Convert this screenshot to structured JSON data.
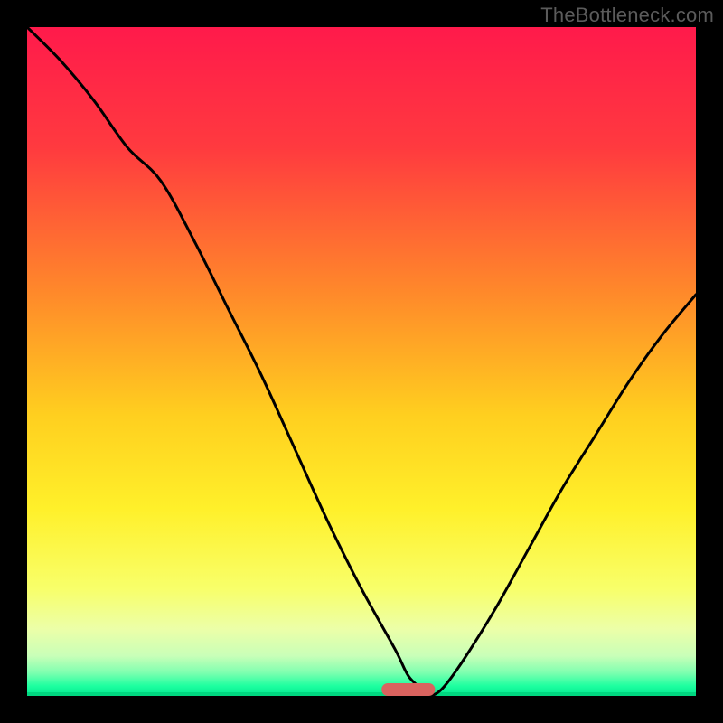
{
  "watermark": "TheBottleneck.com",
  "chart_data": {
    "type": "line",
    "title": "",
    "xlabel": "",
    "ylabel": "",
    "xlim": [
      0,
      100
    ],
    "ylim": [
      0,
      100
    ],
    "series": [
      {
        "name": "bottleneck-curve",
        "x": [
          0,
          5,
          10,
          15,
          20,
          25,
          30,
          35,
          40,
          45,
          50,
          55,
          57,
          59,
          60,
          62,
          65,
          70,
          75,
          80,
          85,
          90,
          95,
          100
        ],
        "y": [
          100,
          95,
          89,
          82,
          77,
          68,
          58,
          48,
          37,
          26,
          16,
          7,
          3,
          1,
          0,
          1,
          5,
          13,
          22,
          31,
          39,
          47,
          54,
          60
        ]
      }
    ],
    "marker": {
      "name": "sweet-spot",
      "x": 57,
      "width": 8,
      "color": "#d9635f"
    },
    "gradient_stops": [
      {
        "pos": 0.0,
        "color": "#ff1a4b"
      },
      {
        "pos": 0.18,
        "color": "#ff3a3f"
      },
      {
        "pos": 0.4,
        "color": "#ff8a2a"
      },
      {
        "pos": 0.58,
        "color": "#ffcf1f"
      },
      {
        "pos": 0.72,
        "color": "#fff02a"
      },
      {
        "pos": 0.84,
        "color": "#f8ff6a"
      },
      {
        "pos": 0.9,
        "color": "#ecffa8"
      },
      {
        "pos": 0.94,
        "color": "#c9ffb8"
      },
      {
        "pos": 0.965,
        "color": "#7fffb0"
      },
      {
        "pos": 0.985,
        "color": "#1effa0"
      },
      {
        "pos": 1.0,
        "color": "#00e88f"
      }
    ]
  }
}
